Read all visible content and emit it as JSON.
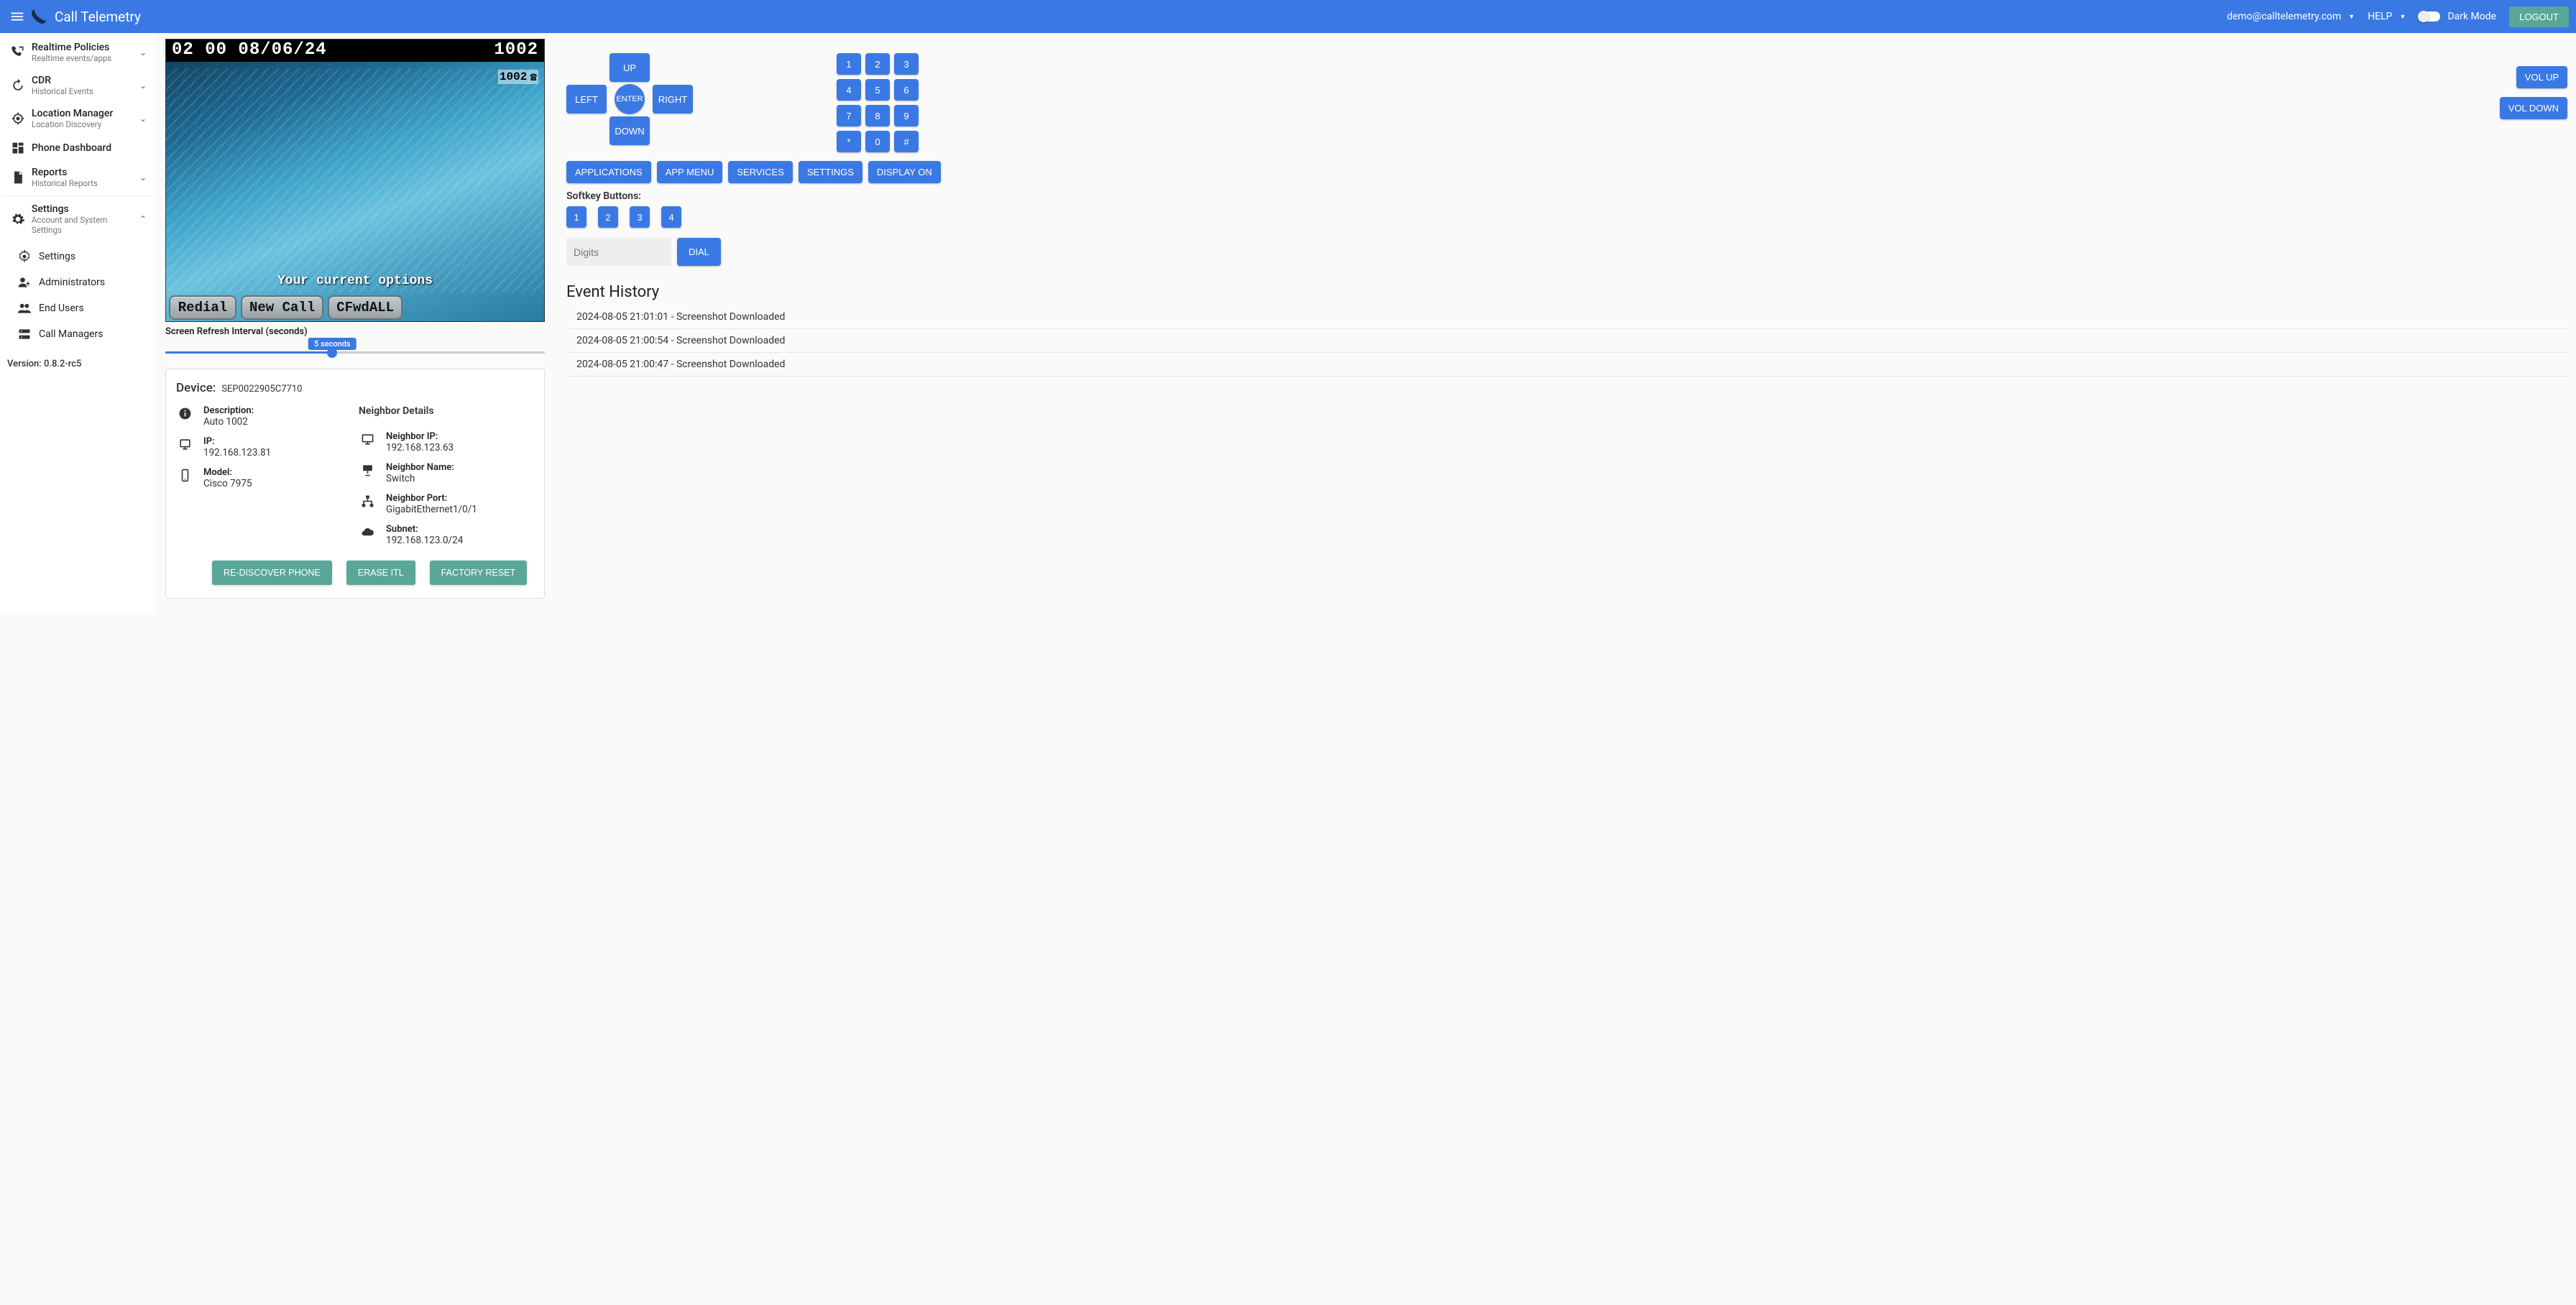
{
  "header": {
    "title": "Call Telemetry",
    "user_email": "demo@calltelemetry.com",
    "help": "HELP",
    "dark_mode": "Dark Mode",
    "logout": "LOGOUT"
  },
  "sidebar": {
    "items": [
      {
        "label": "Realtime Policies",
        "sub": "Realtime events/apps",
        "expandable": true
      },
      {
        "label": "CDR",
        "sub": "Historical Events",
        "expandable": true
      },
      {
        "label": "Location Manager",
        "sub": "Location Discovery",
        "expandable": true
      },
      {
        "label": "Phone Dashboard",
        "sub": "",
        "expandable": false
      },
      {
        "label": "Reports",
        "sub": "Historical Reports",
        "expandable": true
      },
      {
        "label": "Settings",
        "sub": "Account and System Settings",
        "expandable": true,
        "expanded": true
      }
    ],
    "settings_children": [
      {
        "label": "Settings"
      },
      {
        "label": "Administrators"
      },
      {
        "label": "End Users"
      },
      {
        "label": "Call Managers"
      }
    ],
    "version": "Version: 0.8.2-rc5"
  },
  "phone_screen": {
    "time_date": "02 00 08/06/24",
    "extension_top": "1002",
    "line_badge": "1002",
    "options_text": "Your current options",
    "softkeys": [
      "Redial",
      "New Call",
      "CFwdALL"
    ]
  },
  "refresh": {
    "label": "Screen Refresh Interval (seconds)",
    "tooltip": "5 seconds"
  },
  "device": {
    "title": "Device:",
    "id": "SEP0022905C7710",
    "description_label": "Description:",
    "description": "Auto 1002",
    "ip_label": "IP:",
    "ip": "192.168.123.81",
    "model_label": "Model:",
    "model": "Cisco 7975",
    "neighbor_title": "Neighbor Details",
    "neighbor_ip_label": "Neighbor IP:",
    "neighbor_ip": "192.168.123.63",
    "neighbor_name_label": "Neighbor Name:",
    "neighbor_name": "Switch",
    "neighbor_port_label": "Neighbor Port:",
    "neighbor_port": "GigabitEthernet1/0/1",
    "subnet_label": "Subnet:",
    "subnet": "192.168.123.0/24",
    "rediscover": "RE-DISCOVER PHONE",
    "erase_itl": "ERASE ITL",
    "factory_reset": "FACTORY RESET"
  },
  "controls": {
    "up": "UP",
    "down": "DOWN",
    "left": "LEFT",
    "right": "RIGHT",
    "enter": "ENTER",
    "keypad": [
      "1",
      "2",
      "3",
      "4",
      "5",
      "6",
      "7",
      "8",
      "9",
      "*",
      "0",
      "#"
    ],
    "vol_up": "VOL UP",
    "vol_down": "VOL DOWN",
    "menu_buttons": [
      "APPLICATIONS",
      "APP MENU",
      "SERVICES",
      "SETTINGS",
      "DISPLAY ON"
    ],
    "softkey_label": "Softkey Buttons:",
    "softkey_buttons": [
      "1",
      "2",
      "3",
      "4"
    ],
    "digits_placeholder": "Digits",
    "dial": "DIAL"
  },
  "history": {
    "title": "Event History",
    "items": [
      "2024-08-05 21:01:01 - Screenshot Downloaded",
      "2024-08-05 21:00:54 - Screenshot Downloaded",
      "2024-08-05 21:00:47 - Screenshot Downloaded"
    ]
  }
}
